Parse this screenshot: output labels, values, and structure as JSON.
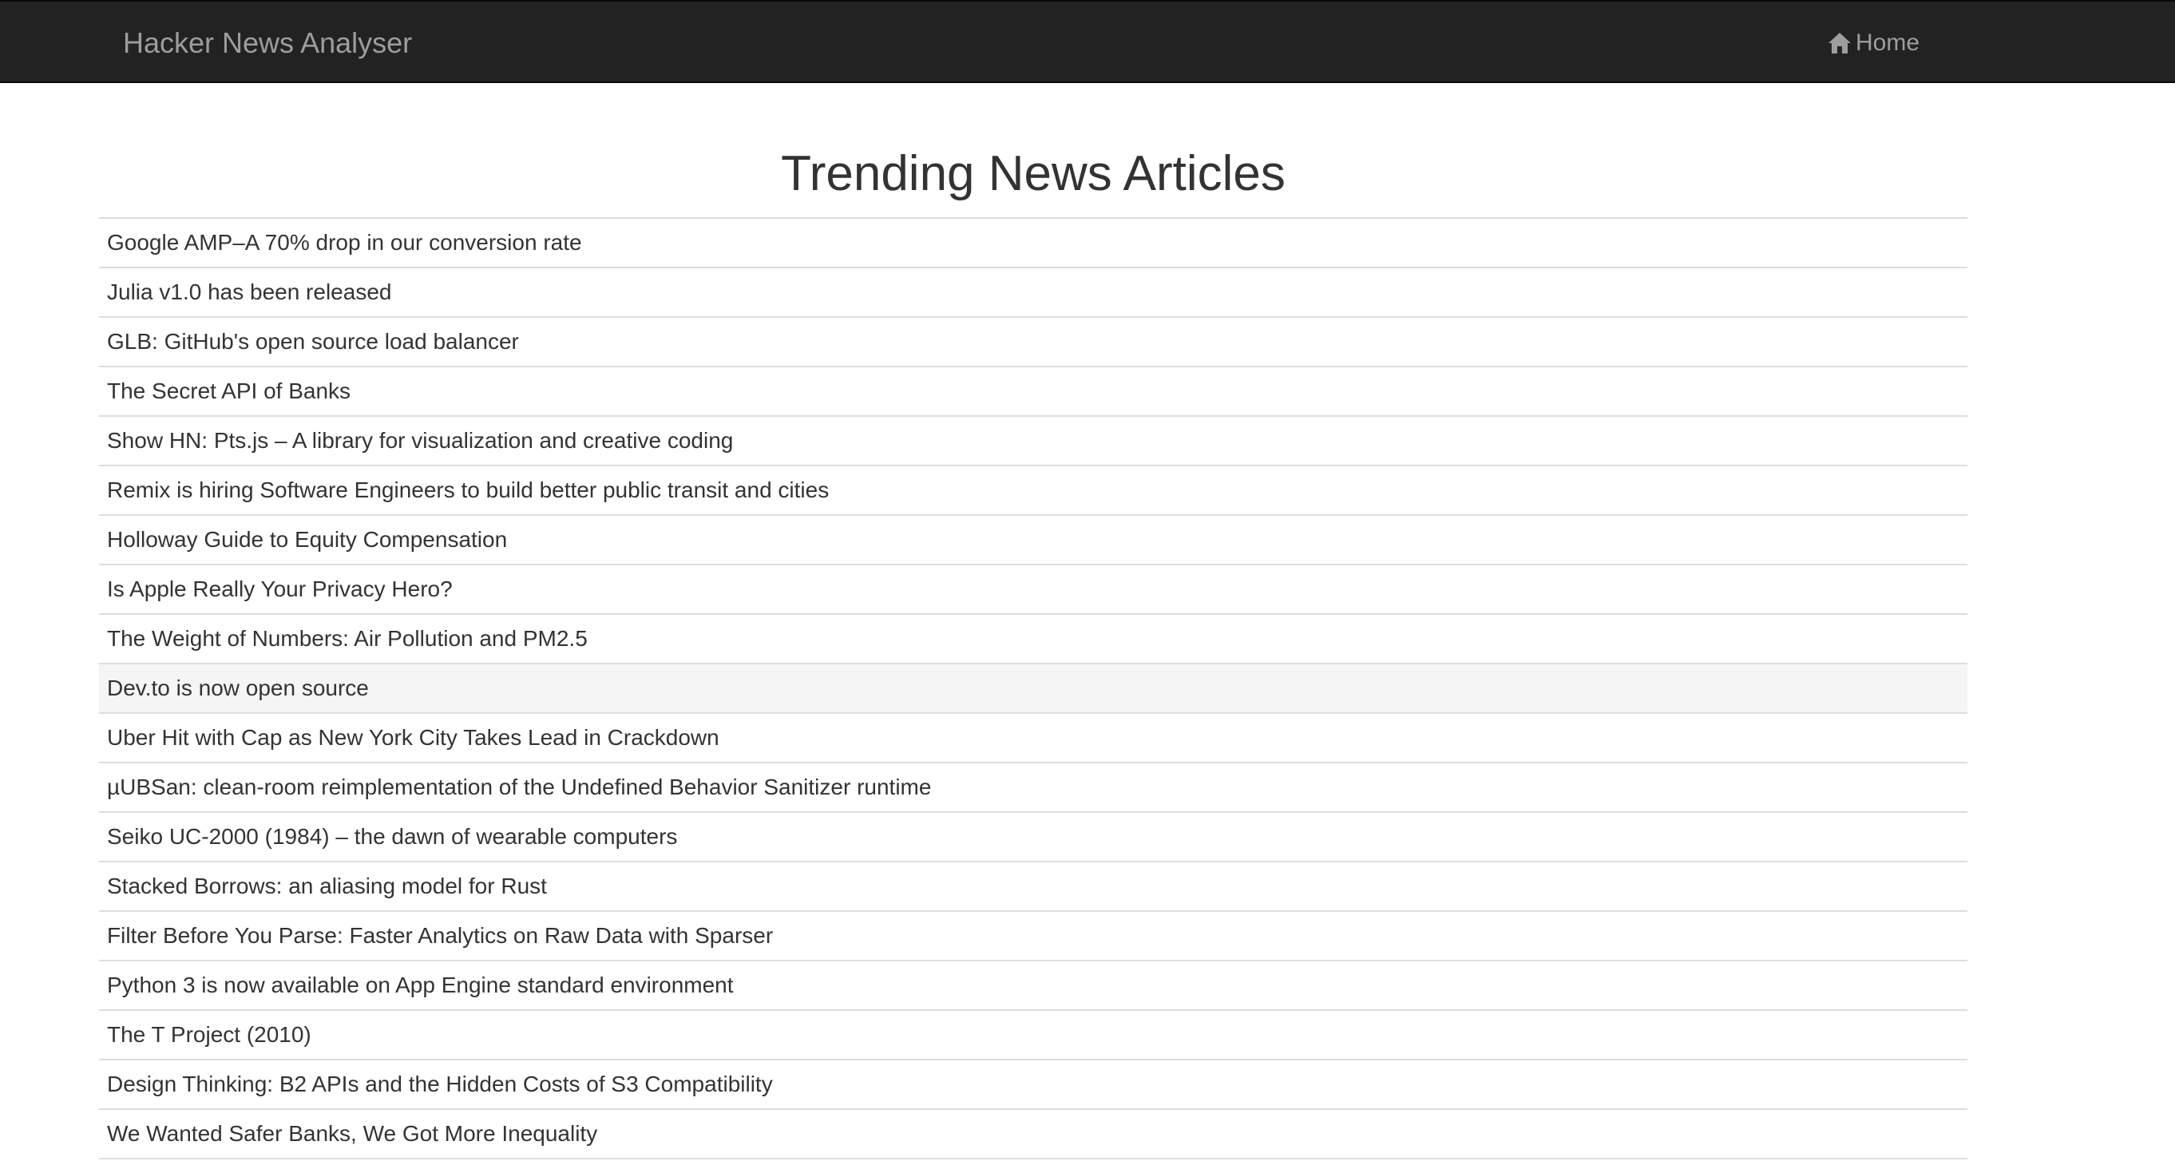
{
  "navbar": {
    "brand": "Hacker News Analyser",
    "home_label": "Home",
    "home_icon": "home-icon"
  },
  "main": {
    "title": "Trending News Articles",
    "articles": [
      "Google AMP–A 70% drop in our conversion rate",
      "Julia v1.0 has been released",
      "GLB: GitHub's open source load balancer",
      "The Secret API of Banks",
      "Show HN: Pts.js – A library for visualization and creative coding",
      "Remix is hiring Software Engineers to build better public transit and cities",
      "Holloway Guide to Equity Compensation",
      "Is Apple Really Your Privacy Hero?",
      "The Weight of Numbers: Air Pollution and PM2.5",
      "Dev.to is now open source",
      "Uber Hit with Cap as New York City Takes Lead in Crackdown",
      "µUBSan: clean-room reimplementation of the Undefined Behavior Sanitizer runtime",
      "Seiko UC-2000 (1984) – the dawn of wearable computers",
      "Stacked Borrows: an aliasing model for Rust",
      "Filter Before You Parse: Faster Analytics on Raw Data with Sparser",
      "Python 3 is now available on App Engine standard environment",
      "The T Project (2010)",
      "Design Thinking: B2 APIs and the Hidden Costs of S3 Compatibility",
      "We Wanted Safer Banks, We Got More Inequality"
    ]
  }
}
